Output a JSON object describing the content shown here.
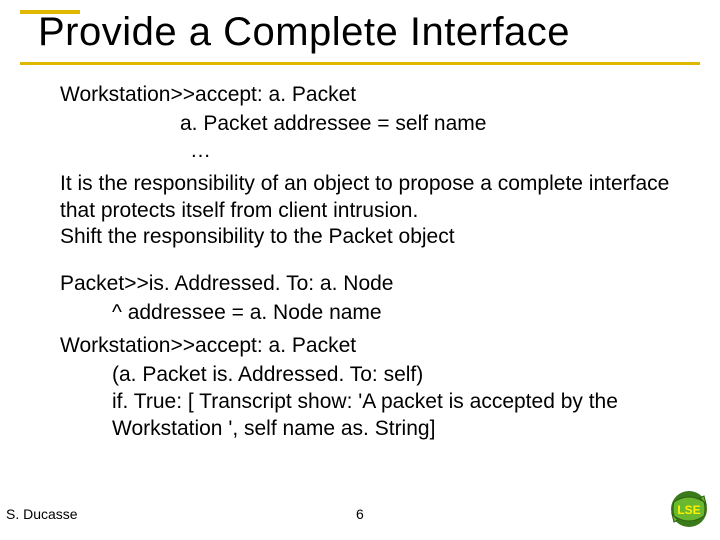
{
  "title": "Provide a Complete Interface",
  "body": {
    "code_header_1": "Workstation>>accept: a. Packet",
    "code_indent_1a": "a. Packet addressee = self name",
    "code_indent_1b": "…",
    "paragraph": "It is the responsibility of an object to propose a complete interface that protects itself from client intrusion.\nShift the responsibility to the Packet object",
    "code_header_2": "Packet>>is. Addressed. To: a. Node",
    "code_indent_2": "^ addressee = a. Node name",
    "code_header_3": "Workstation>>accept: a. Packet",
    "code_indent_3": "(a. Packet is. Addressed. To: self)\nif. True: [ Transcript show: 'A packet  is accepted by the Workstation ', self name as. String]"
  },
  "footer": {
    "author": "S. Ducasse",
    "page": "6"
  },
  "logo_label": "LSE"
}
